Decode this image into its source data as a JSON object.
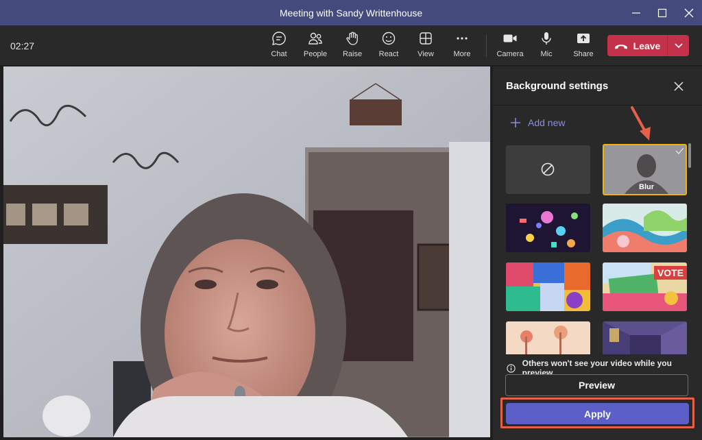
{
  "window": {
    "title": "Meeting with Sandy Writtenhouse"
  },
  "meeting": {
    "elapsed": "02:27"
  },
  "toolbar": {
    "chat": "Chat",
    "people": "People",
    "raise": "Raise",
    "react": "React",
    "view": "View",
    "more": "More",
    "camera": "Camera",
    "mic": "Mic",
    "share": "Share",
    "leave": "Leave"
  },
  "panel": {
    "title": "Background settings",
    "add_new": "Add new",
    "blur_label": "Blur",
    "info": "Others won't see your video while you preview.",
    "preview": "Preview",
    "apply": "Apply"
  },
  "thumbnails": [
    {
      "name": "none",
      "selected": false
    },
    {
      "name": "blur",
      "selected": true
    },
    {
      "name": "neon-shapes",
      "selected": false
    },
    {
      "name": "colorful-waves",
      "selected": false
    },
    {
      "name": "abstract-collage",
      "selected": false
    },
    {
      "name": "vote-art",
      "selected": false
    },
    {
      "name": "desert-scene",
      "selected": false
    },
    {
      "name": "purple-room",
      "selected": false
    }
  ],
  "thumb_vote_text": "VOTE",
  "colors": {
    "accent": "#5b5fc7",
    "leave": "#c4314b",
    "highlight": "#e7604a",
    "selected_border": "#f2b400",
    "titlebar": "#454a7c"
  }
}
